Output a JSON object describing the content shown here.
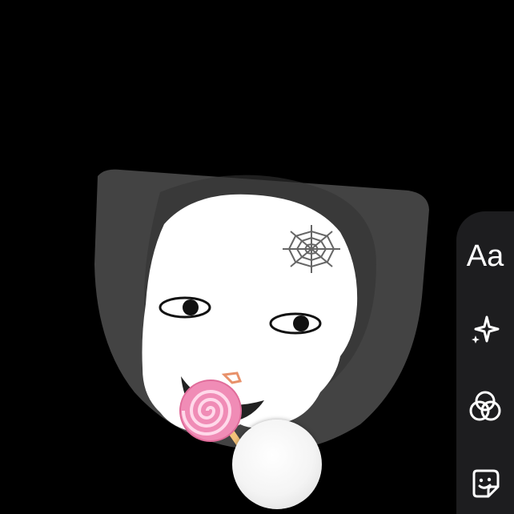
{
  "toolbar": {
    "text_tool_label": "Aa",
    "sparkle_icon": "sparkle-icon",
    "filters_icon": "filters-icon",
    "sticker_icon": "sticker-icon"
  },
  "colors": {
    "background": "#000000",
    "rail": "#1d1d1f",
    "accent_candy": "#f08cb6"
  }
}
